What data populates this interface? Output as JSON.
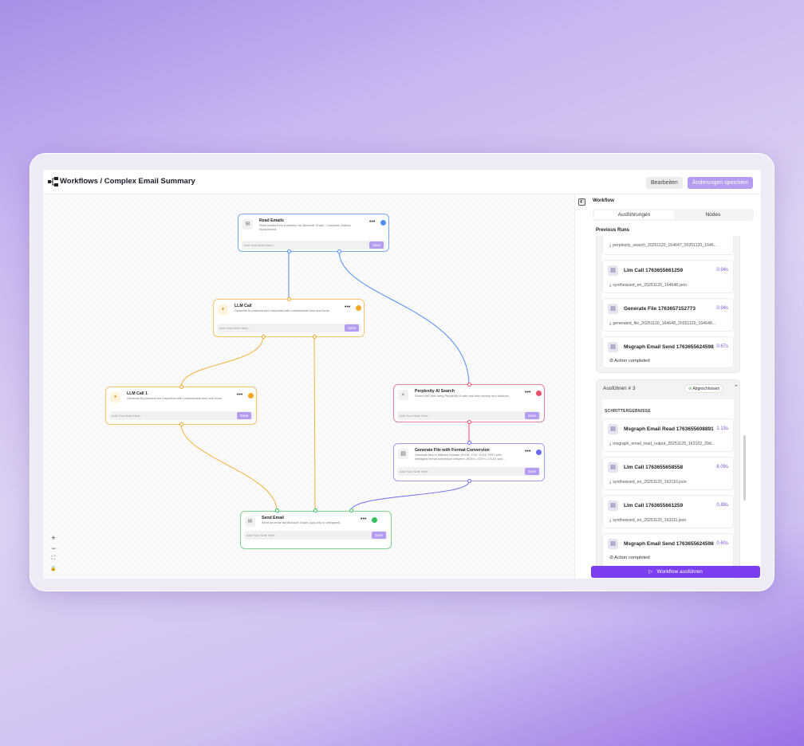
{
  "header": {
    "title": "Workflows / Complex Email Summary",
    "edit_label": "Bearbeiten",
    "save_label": "Änderungen speichern"
  },
  "nodes": {
    "read_emails": {
      "title": "Read Emails",
      "desc": "Read emails from a mailbox via Microsoft Graph - Complete Outlook replacement",
      "notes": "Add Your Note Here..",
      "save": "Save",
      "status_color": "#4f8ff7"
    },
    "llm_call": {
      "title": "LLM Call",
      "desc": "Generate AI-powered text responses with customizable tone and focus",
      "notes": "Add Your Note Here..",
      "save": "Save",
      "status_color": "#f5a623"
    },
    "llm_call_1": {
      "title": "LLM Call 1",
      "desc": "Generate AI-powered text responses with customizable tone and focus",
      "notes": "Add Your Note Here..",
      "save": "Save",
      "status_color": "#f5a623"
    },
    "perplexity": {
      "title": "Perplexity AI Search",
      "desc": "Search the web using Perplexity AI with real-time access and citations",
      "notes": "Add Your Note Here..",
      "save": "Save",
      "status_color": "#ee4d6a"
    },
    "generate_file": {
      "title": "Generate File with Format Conversion",
      "desc": "Generate files in different formats (JSON, CSV, XLSX, PDF) with intelligent format conversion between JSON<->CSV<->XLSX and...",
      "notes": "Add Your Note Here..",
      "save": "Save",
      "status_color": "#6b6cf0"
    },
    "send_email": {
      "title": "Send Email",
      "desc": "Send an email via Microsoft Graph (app-only or delegated)",
      "notes": "Add Your Note Here..",
      "save": "Save",
      "status_color": "#34c05a"
    }
  },
  "zoom": {
    "in": "+",
    "out": "−",
    "fit": "⛶",
    "lock": "🔒"
  },
  "panel": {
    "title": "Workflow",
    "tabs": [
      "Ausführungen",
      "Nodes"
    ],
    "previous_runs": "Previous Runs",
    "run_prev": {
      "first_file": "perplexity_search_20251120_164647_20251120_1646...",
      "steps": [
        {
          "name": "Llm Call 1763655661259",
          "time": "0.94s",
          "file": "synthesized_en_20251120_164648.json"
        },
        {
          "name": "Generate File 1763657152773",
          "time": "0.94s",
          "file": "generated_file_20251120_164648_20251120_164648..."
        },
        {
          "name": "Msgraph Email Send 1763655624598",
          "time": "0.67s",
          "action": "Action completed"
        }
      ]
    },
    "run3": {
      "label": "Ausführen # 3",
      "status": "Abgeschlossen",
      "steps_header": "SCHRITTERGEBNISSE",
      "steps": [
        {
          "name": "Msgraph Email Read 1763655608891",
          "time": "1.13s",
          "file": "msgraph_email_read_output_20251120_163102_29d..."
        },
        {
          "name": "Llm Call 1763655658558",
          "time": "8.09s",
          "file": "synthesized_en_20251120_163110.json"
        },
        {
          "name": "Llm Call 1763655661259",
          "time": "0.88s",
          "file": "synthesized_en_20251120_163111.json"
        },
        {
          "name": "Msgraph Email Send 1763655624598",
          "time": "0.60s",
          "action": "Action completed"
        }
      ]
    },
    "run_button": "Workflow ausführen"
  }
}
